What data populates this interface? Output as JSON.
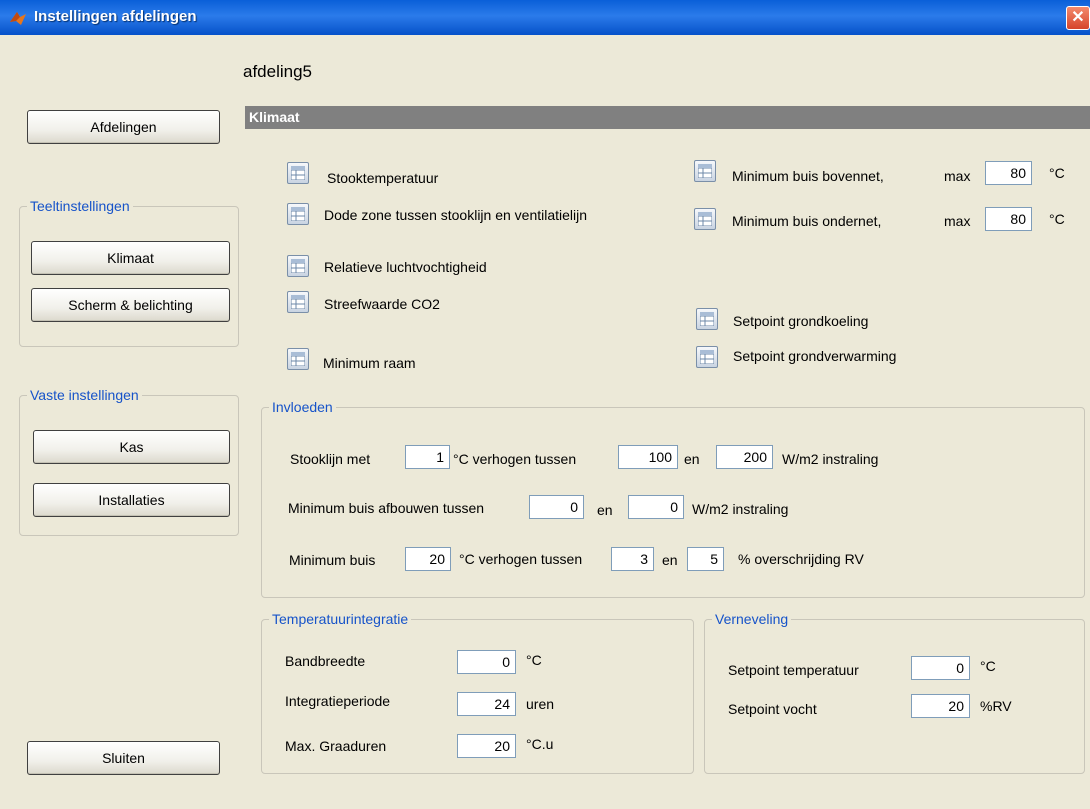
{
  "window": {
    "title": "Instellingen afdelingen",
    "close_glyph": "✕"
  },
  "department_name": "afdeling5",
  "sidebar": {
    "afdelingen_button": "Afdelingen",
    "teelt_group": {
      "title": "Teeltinstellingen",
      "klimaat": "Klimaat",
      "scherm": "Scherm & belichting"
    },
    "vaste_group": {
      "title": "Vaste instellingen",
      "kas": "Kas",
      "installaties": "Installaties"
    },
    "sluiten_button": "Sluiten"
  },
  "klimaat": {
    "header": "Klimaat",
    "left_items": [
      "Stooktemperatuur",
      "Dode zone tussen stooklijn en ventilatielijn",
      "Relatieve luchtvochtigheid",
      "Streefwaarde CO2",
      "Minimum raam"
    ],
    "buis_bovennet": {
      "label": "Minimum buis bovennet,",
      "max_label": "max",
      "value": "80",
      "unit": "°C"
    },
    "buis_ondernet": {
      "label": "Minimum buis ondernet,",
      "max_label": "max",
      "value": "80",
      "unit": "°C"
    },
    "grondkoeling": "Setpoint grondkoeling",
    "grondverwarming": "Setpoint grondverwarming"
  },
  "invloeden": {
    "title": "Invloeden",
    "row1": {
      "label": "Stooklijn met",
      "v1": "1",
      "mid": "°C verhogen tussen",
      "v2": "100",
      "en": "en",
      "v3": "200",
      "tail": "W/m2 instraling"
    },
    "row2": {
      "label": "Minimum buis afbouwen tussen",
      "v1": "0",
      "en": "en",
      "v2": "0",
      "tail": "W/m2 instraling"
    },
    "row3": {
      "label": "Minimum buis",
      "v1": "20",
      "mid": "°C verhogen tussen",
      "v2": "3",
      "en": "en",
      "v3": "5",
      "tail": "% overschrijding RV"
    }
  },
  "temperatuurintegratie": {
    "title": "Temperatuurintegratie",
    "bandbreedte": {
      "label": "Bandbreedte",
      "value": "0",
      "unit": "°C"
    },
    "integratieperiode": {
      "label": "Integratieperiode",
      "value": "24",
      "unit": "uren"
    },
    "graaduren": {
      "label": "Max. Graaduren",
      "value": "20",
      "unit": "°C.u"
    }
  },
  "verneveling": {
    "title": "Verneveling",
    "temperatuur": {
      "label": "Setpoint temperatuur",
      "value": "0",
      "unit": "°C"
    },
    "vocht": {
      "label": "Setpoint vocht",
      "value": "20",
      "unit": "%RV"
    }
  }
}
